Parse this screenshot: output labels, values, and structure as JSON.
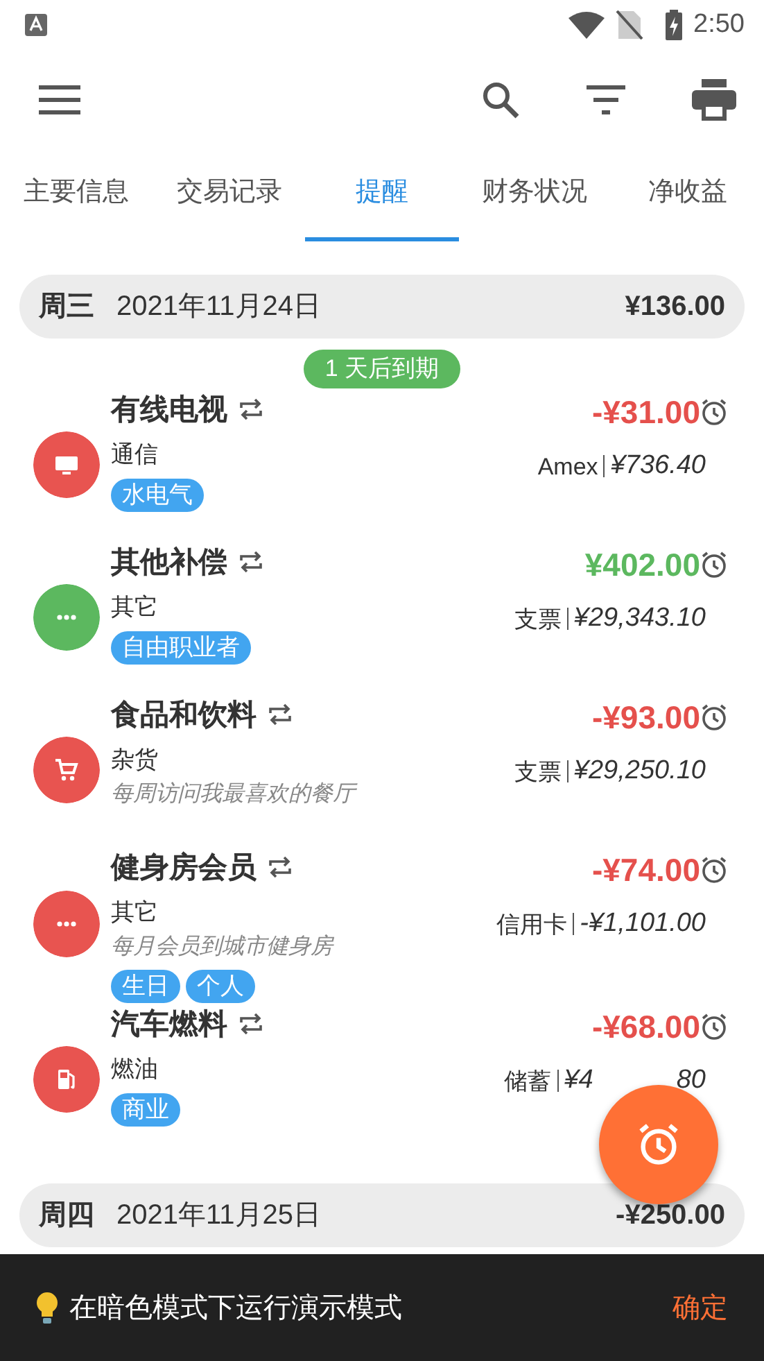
{
  "status_bar": {
    "time": "2:50"
  },
  "tabs": [
    {
      "label": "主要信息",
      "selected": false
    },
    {
      "label": "交易记录",
      "selected": false
    },
    {
      "label": "提醒",
      "selected": true
    },
    {
      "label": "财务状况",
      "selected": false
    },
    {
      "label": "净收益",
      "selected": false
    }
  ],
  "groups": [
    {
      "weekday": "周三",
      "date": "2021年11月24日",
      "total": "¥136.00",
      "due_badge": "1 天后到期",
      "items": [
        {
          "kind": "tv",
          "color": "#e85450",
          "title": "有线电视",
          "income": false,
          "amount": "-¥31.00",
          "category": "通信",
          "account": "Amex",
          "balance": "¥736.40",
          "tags": [
            "水电气"
          ]
        },
        {
          "kind": "more",
          "color": "#5cb85f",
          "title": "其他补偿",
          "income": true,
          "amount": "¥402.00",
          "category": "其它",
          "account": "支票",
          "balance": "¥29,343.10",
          "tags": [
            "自由职业者"
          ]
        },
        {
          "kind": "cart",
          "color": "#e85450",
          "title": "食品和饮料",
          "income": false,
          "amount": "-¥93.00",
          "category": "杂货",
          "account": "支票",
          "balance": "¥29,250.10",
          "note": "每周访问我最喜欢的餐厅"
        },
        {
          "kind": "more",
          "color": "#e85450",
          "title": "健身房会员",
          "income": false,
          "amount": "-¥74.00",
          "category": "其它",
          "account": "信用卡",
          "balance": "-¥1,101.00",
          "note": "每月会员到城市健身房",
          "tags": [
            "生日",
            "个人"
          ]
        },
        {
          "kind": "fuel",
          "color": "#e85450",
          "title": "汽车燃料",
          "income": false,
          "amount": "-¥68.00",
          "category": "燃油",
          "account": "储蓄",
          "balance": "¥4",
          "balance_tail": "80",
          "tags": [
            "商业"
          ]
        }
      ]
    },
    {
      "weekday": "周四",
      "date": "2021年11月25日",
      "total": "-¥250.00"
    }
  ],
  "snackbar": {
    "message": "在暗色模式下运行演示模式",
    "action": "确定"
  }
}
